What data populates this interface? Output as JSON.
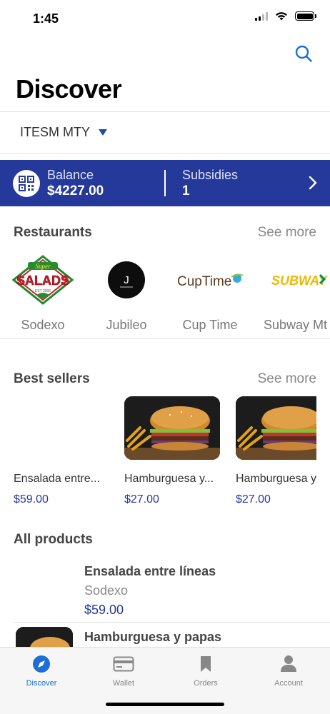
{
  "status_bar": {
    "time": "1:45"
  },
  "header": {
    "title": "Discover",
    "search_icon": "search-icon"
  },
  "location": {
    "label": "ITESM MTY"
  },
  "balance": {
    "balance_label": "Balance",
    "balance_value": "$4227.00",
    "subsidies_label": "Subsidies",
    "subsidies_value": "1"
  },
  "restaurants": {
    "title": "Restaurants",
    "see_more": "See more",
    "items": [
      {
        "name": "Sodexo",
        "logo_text_top": "Super",
        "logo_text_main": "SALADS",
        "logo_text_bottom": "EST 2006"
      },
      {
        "name": "Jubileo",
        "logo_text_main": "J"
      },
      {
        "name": "Cup Time",
        "logo_text_main": "CupTime"
      },
      {
        "name": "Subway Mt",
        "logo_text_main": "SUBWAY"
      }
    ]
  },
  "best_sellers": {
    "title": "Best sellers",
    "see_more": "See more",
    "items": [
      {
        "name": "Ensalada entre...",
        "price": "$59.00"
      },
      {
        "name": "Hamburguesa y...",
        "price": "$27.00"
      },
      {
        "name": "Hamburguesa y",
        "price": "$27.00"
      }
    ]
  },
  "all_products": {
    "title": "All products",
    "items": [
      {
        "name": "Ensalada entre líneas",
        "vendor": "Sodexo",
        "price": "$59.00"
      },
      {
        "name": "Hamburguesa y papas"
      }
    ]
  },
  "tabs": [
    {
      "label": "Discover",
      "icon": "compass-icon",
      "active": true
    },
    {
      "label": "Wallet",
      "icon": "card-icon",
      "active": false
    },
    {
      "label": "Orders",
      "icon": "bookmark-icon",
      "active": false
    },
    {
      "label": "Account",
      "icon": "person-icon",
      "active": false
    }
  ],
  "colors": {
    "accent": "#24399a",
    "tab_active": "#1b6fd6",
    "search": "#1b6fd6"
  }
}
